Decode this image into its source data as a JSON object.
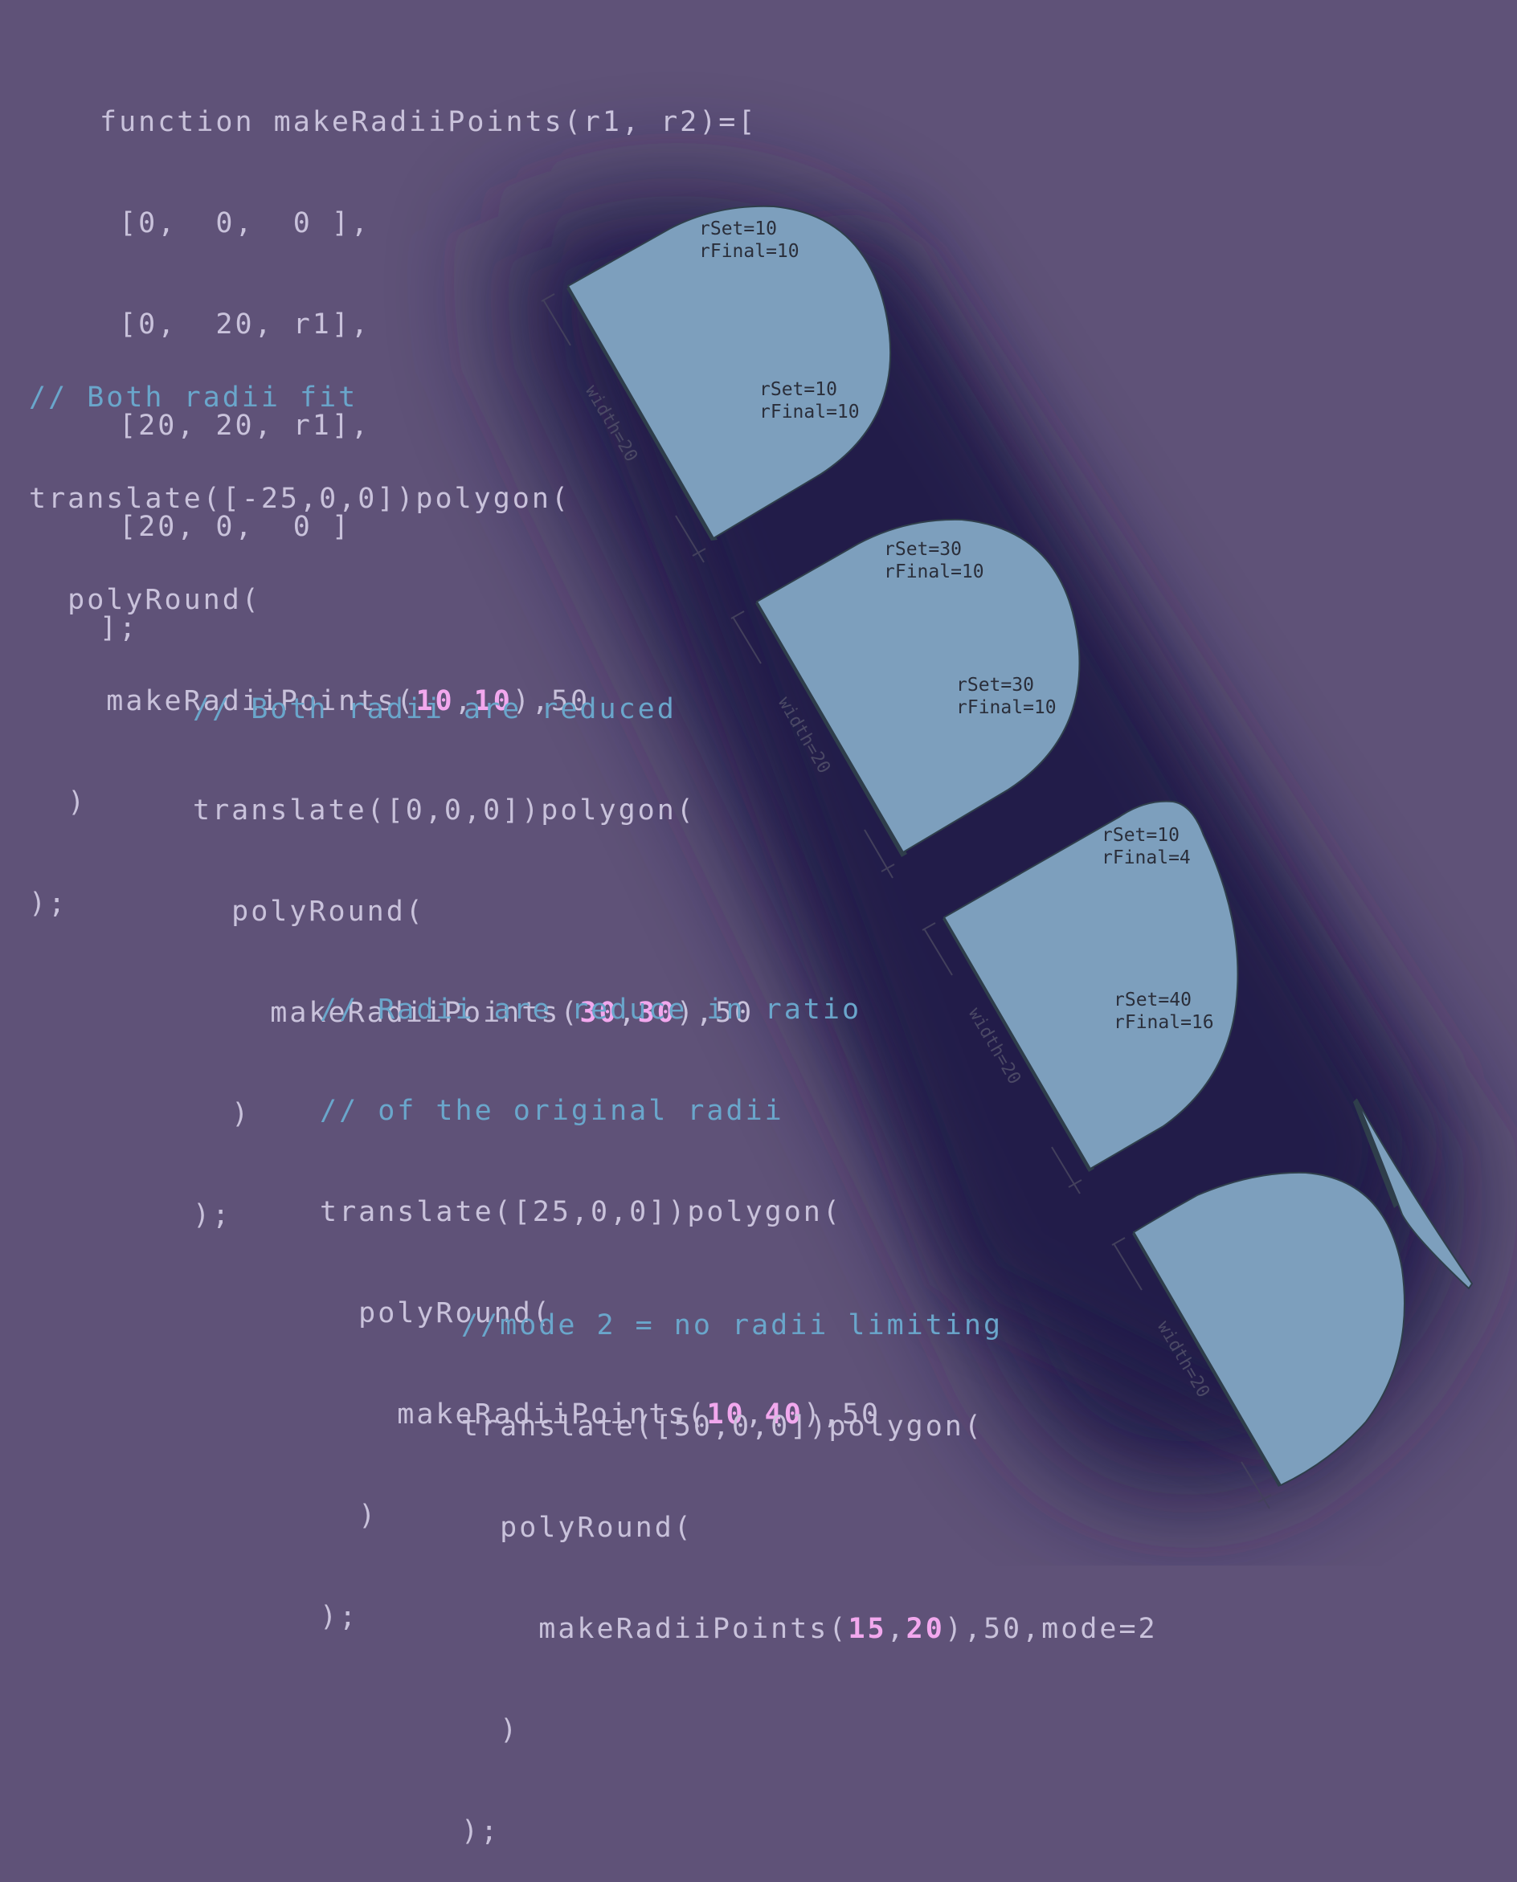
{
  "colors": {
    "background": "#5f5278",
    "shadow": "#241c4a",
    "shape_fill": "#7d9fbd",
    "shape_edge": "#2f3e4b",
    "code_text": "#c9c2db",
    "comment_text": "#6aa6cb",
    "highlight_number": "#f2a8ee"
  },
  "function_def": {
    "lines": [
      "function makeRadiiPoints(r1, r2)=[",
      " [0,  0,  0 ],",
      " [0,  20, r1],",
      " [20, 20, r1],",
      " [20, 0,  0 ]",
      "];"
    ]
  },
  "examples": [
    {
      "comment": [
        "// Both radii fit"
      ],
      "translate_line": "translate([-25,0,0])polygon(",
      "polyround_line": "  polyRound(",
      "call_prefix": "    makeRadiiPoints(",
      "r1": "10",
      "comma": ",",
      "r2": "10",
      "call_suffix": "),50",
      "close_paren": "  )",
      "close_stmt": ");",
      "shape": {
        "top_label": [
          "rSet=10",
          "rFinal=10"
        ],
        "right_label": [
          "rSet=10",
          "rFinal=10"
        ],
        "width_label": "width=20"
      }
    },
    {
      "comment": [
        "// Both radii are reduced"
      ],
      "translate_line": "translate([0,0,0])polygon(",
      "polyround_line": "  polyRound(",
      "call_prefix": "    makeRadiiPoints(",
      "r1": "30",
      "comma": ",",
      "r2": "30",
      "call_suffix": "),50",
      "close_paren": "  )",
      "close_stmt": ");",
      "shape": {
        "top_label": [
          "rSet=30",
          "rFinal=10"
        ],
        "right_label": [
          "rSet=30",
          "rFinal=10"
        ],
        "width_label": "width=20"
      }
    },
    {
      "comment": [
        "// Radii are reduce in ratio",
        "// of the original radii"
      ],
      "translate_line": "translate([25,0,0])polygon(",
      "polyround_line": "  polyRound(",
      "call_prefix": "    makeRadiiPoints(",
      "r1": "10",
      "comma": ",",
      "r2": "40",
      "call_suffix": "),50",
      "close_paren": "  )",
      "close_stmt": ");",
      "shape": {
        "top_label": [
          "rSet=10",
          "rFinal=4"
        ],
        "right_label": [
          "rSet=40",
          "rFinal=16"
        ],
        "width_label": "width=20"
      }
    },
    {
      "comment": [
        "//mode 2 = no radii limiting"
      ],
      "translate_line": "translate([50,0,0])polygon(",
      "polyround_line": "  polyRound(",
      "call_prefix": "    makeRadiiPoints(",
      "r1": "15",
      "comma": ",",
      "r2": "20",
      "call_suffix": "),50,mode=2",
      "close_paren": "  )",
      "close_stmt": ");",
      "shape": {
        "width_label": "width=20"
      }
    }
  ]
}
